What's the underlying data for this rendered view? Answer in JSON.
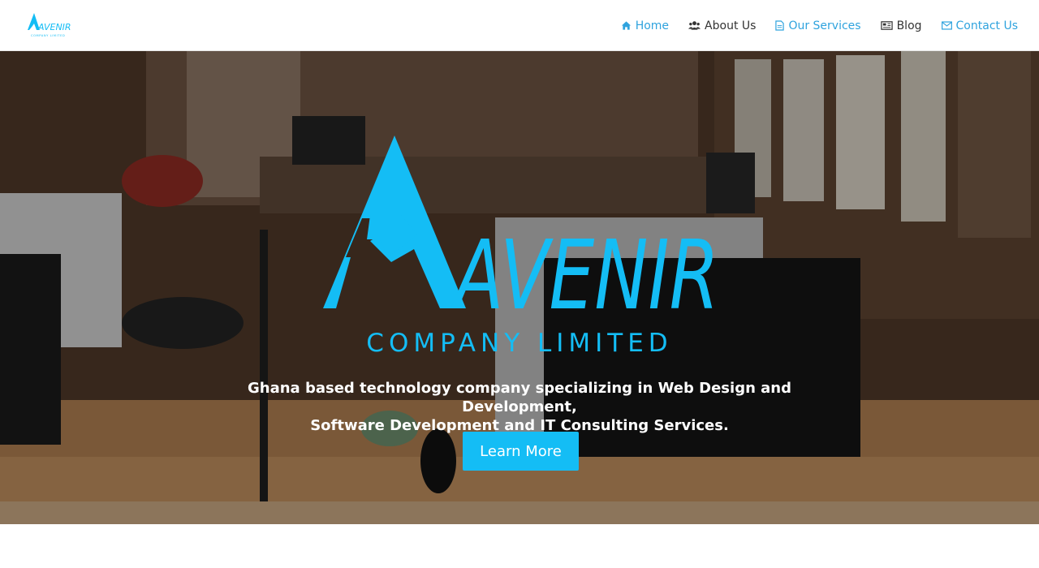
{
  "brand": {
    "name": "AVENIR",
    "subtitle": "COMPANY LIMITED",
    "color": "#14bdf5"
  },
  "nav": {
    "items": [
      {
        "label": "Home",
        "icon": "home-icon",
        "active": true
      },
      {
        "label": "About Us",
        "icon": "users-icon",
        "active": false
      },
      {
        "label": "Our Services",
        "icon": "document-icon",
        "active": true
      },
      {
        "label": "Blog",
        "icon": "newspaper-icon",
        "active": false
      },
      {
        "label": "Contact Us",
        "icon": "envelope-icon",
        "active": true
      }
    ],
    "accent_color": "#2fa3de",
    "text_color": "#333333"
  },
  "hero": {
    "background": "office-interior-photo",
    "title": "AVENIR",
    "subtitle": "COMPANY LIMITED",
    "tagline_line1": "Ghana based technology company specializing in Web Design and Development,",
    "tagline_line2": "Software Development and IT Consulting Services.",
    "cta_label": "Learn More",
    "cta_color": "#14bdf5"
  }
}
